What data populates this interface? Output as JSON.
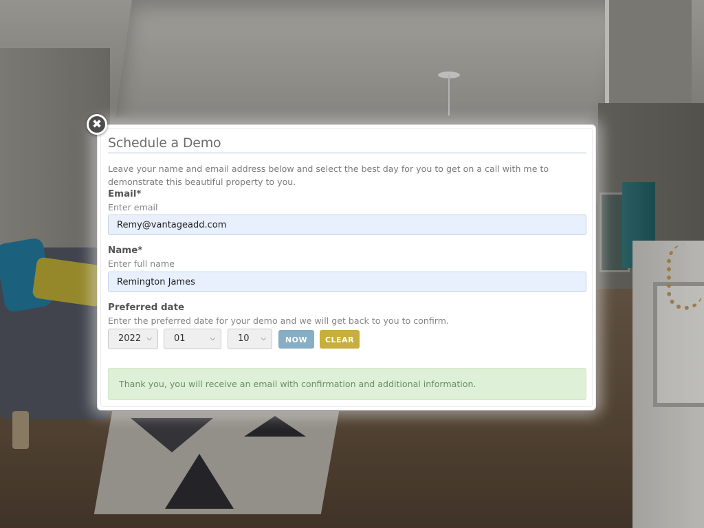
{
  "modal": {
    "title": "Schedule a Demo",
    "close_icon": "close-icon",
    "close_glyph": "✖",
    "intro": "Leave your name and email address below and select the best day for you to get on a call with me to demonstrate this beautiful property to you."
  },
  "form": {
    "email": {
      "label": "Email*",
      "hint": "Enter email",
      "value": "Remy@vantageadd.com"
    },
    "name": {
      "label": "Name*",
      "hint": "Enter full name",
      "value": "Remington James"
    },
    "date": {
      "label": "Preferred date",
      "hint": "Enter the preferred date for your demo and we will get back to you to confirm.",
      "year": "2022",
      "month": "01",
      "day": "10"
    },
    "now_button": "NOW",
    "clear_button": "CLEAR"
  },
  "alert": {
    "message": "Thank you, you will receive an email with confirmation and additional information."
  },
  "colors": {
    "now_button": "#86aec4",
    "clear_button": "#c8ae3d",
    "input_bg": "#e8f0fe",
    "alert_bg": "#dff0d8",
    "alert_text": "#6b8e63"
  }
}
